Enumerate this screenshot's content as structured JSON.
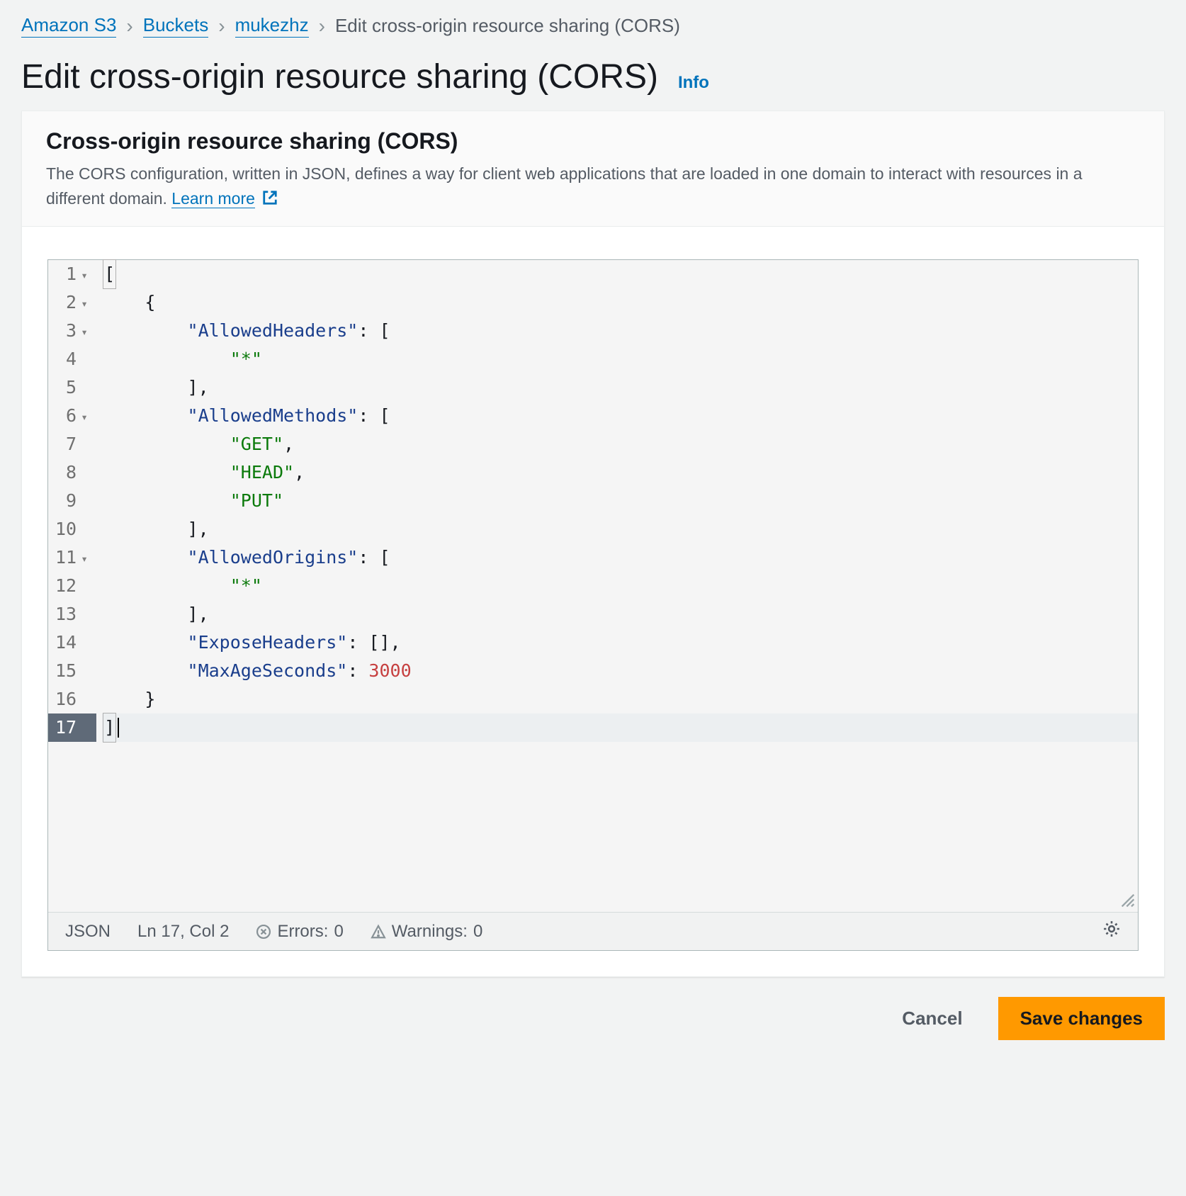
{
  "breadcrumb": {
    "items": [
      {
        "label": "Amazon S3",
        "link": true
      },
      {
        "label": "Buckets",
        "link": true
      },
      {
        "label": "mukezhz",
        "link": true
      },
      {
        "label": "Edit cross-origin resource sharing (CORS)",
        "link": false
      }
    ]
  },
  "header": {
    "title": "Edit cross-origin resource sharing (CORS)",
    "info": "Info"
  },
  "panel": {
    "title": "Cross-origin resource sharing (CORS)",
    "description": "The CORS configuration, written in JSON, defines a way for client web applications that are loaded in one domain to interact with resources in a different domain. ",
    "learn_more": "Learn more"
  },
  "editor": {
    "line_count": 17,
    "fold_lines": [
      1,
      2,
      3,
      6,
      11
    ],
    "active_line": 17,
    "code_tokens": [
      [
        {
          "t": "bracket-box",
          "v": "["
        }
      ],
      [
        {
          "t": "indent",
          "v": 4
        },
        {
          "t": "bracket",
          "v": "{"
        }
      ],
      [
        {
          "t": "indent",
          "v": 8
        },
        {
          "t": "key",
          "v": "\"AllowedHeaders\""
        },
        {
          "t": "punct",
          "v": ": "
        },
        {
          "t": "bracket",
          "v": "["
        }
      ],
      [
        {
          "t": "indent",
          "v": 12
        },
        {
          "t": "string",
          "v": "\"*\""
        }
      ],
      [
        {
          "t": "indent",
          "v": 8
        },
        {
          "t": "bracket",
          "v": "]"
        },
        {
          "t": "punct",
          "v": ","
        }
      ],
      [
        {
          "t": "indent",
          "v": 8
        },
        {
          "t": "key",
          "v": "\"AllowedMethods\""
        },
        {
          "t": "punct",
          "v": ": "
        },
        {
          "t": "bracket",
          "v": "["
        }
      ],
      [
        {
          "t": "indent",
          "v": 12
        },
        {
          "t": "string",
          "v": "\"GET\""
        },
        {
          "t": "punct",
          "v": ","
        }
      ],
      [
        {
          "t": "indent",
          "v": 12
        },
        {
          "t": "string",
          "v": "\"HEAD\""
        },
        {
          "t": "punct",
          "v": ","
        }
      ],
      [
        {
          "t": "indent",
          "v": 12
        },
        {
          "t": "string",
          "v": "\"PUT\""
        }
      ],
      [
        {
          "t": "indent",
          "v": 8
        },
        {
          "t": "bracket",
          "v": "]"
        },
        {
          "t": "punct",
          "v": ","
        }
      ],
      [
        {
          "t": "indent",
          "v": 8
        },
        {
          "t": "key",
          "v": "\"AllowedOrigins\""
        },
        {
          "t": "punct",
          "v": ": "
        },
        {
          "t": "bracket",
          "v": "["
        }
      ],
      [
        {
          "t": "indent",
          "v": 12
        },
        {
          "t": "string",
          "v": "\"*\""
        }
      ],
      [
        {
          "t": "indent",
          "v": 8
        },
        {
          "t": "bracket",
          "v": "]"
        },
        {
          "t": "punct",
          "v": ","
        }
      ],
      [
        {
          "t": "indent",
          "v": 8
        },
        {
          "t": "key",
          "v": "\"ExposeHeaders\""
        },
        {
          "t": "punct",
          "v": ": "
        },
        {
          "t": "bracket",
          "v": "["
        },
        {
          "t": "bracket",
          "v": "]"
        },
        {
          "t": "punct",
          "v": ","
        }
      ],
      [
        {
          "t": "indent",
          "v": 8
        },
        {
          "t": "key",
          "v": "\"MaxAgeSeconds\""
        },
        {
          "t": "punct",
          "v": ": "
        },
        {
          "t": "number",
          "v": "3000"
        }
      ],
      [
        {
          "t": "indent",
          "v": 4
        },
        {
          "t": "bracket",
          "v": "}"
        }
      ],
      [
        {
          "t": "bracket-box",
          "v": "]"
        },
        {
          "t": "cursor",
          "v": ""
        }
      ]
    ],
    "status": {
      "language": "JSON",
      "position": "Ln 17, Col 2",
      "errors_label": "Errors:",
      "errors_count": "0",
      "warnings_label": "Warnings:",
      "warnings_count": "0"
    }
  },
  "footer": {
    "cancel": "Cancel",
    "save": "Save changes"
  }
}
